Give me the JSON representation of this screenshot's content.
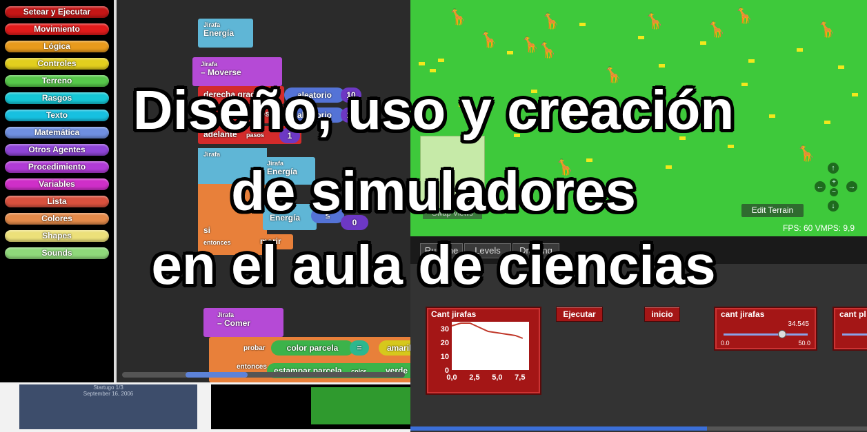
{
  "palette": {
    "categories": [
      {
        "label": "Setear y Ejecutar",
        "color": "#c51616"
      },
      {
        "label": "Movimiento",
        "color": "#e11b1b"
      },
      {
        "label": "Lógica",
        "color": "#e89a1c"
      },
      {
        "label": "Controles",
        "color": "#e2cf1e"
      },
      {
        "label": "Terreno",
        "color": "#57c84a"
      },
      {
        "label": "Rasgos",
        "color": "#15c7d6"
      },
      {
        "label": "Texto",
        "color": "#17c0e0"
      },
      {
        "label": "Matemática",
        "color": "#6f8fe0"
      },
      {
        "label": "Otros Agentes",
        "color": "#8f45d8"
      },
      {
        "label": "Procedimiento",
        "color": "#b03bd6"
      },
      {
        "label": "Variables",
        "color": "#cf2fc8"
      },
      {
        "label": "Lista",
        "color": "#d9513e"
      },
      {
        "label": "Colores",
        "color": "#e48a4a"
      },
      {
        "label": "Shapes",
        "color": "#ece07a"
      },
      {
        "label": "Sounds",
        "color": "#8fd87a"
      }
    ]
  },
  "script": {
    "energia_top": {
      "agent": "Jirafa",
      "label": "Energía"
    },
    "moverse": {
      "agent": "Jirafa",
      "label": "– Moverse"
    },
    "derecha": "derecha  grados",
    "aleatorio1": "aleatorio",
    "aleatorio1_val": "10",
    "izquierda": "izquierda  grados",
    "aleatorio2": "aleatorio",
    "aleatorio2_val": "10",
    "adelante": "adelante",
    "pasos": "pasos",
    "pasos_val": "1",
    "jirafa_label": "Jirafa",
    "energia_mid": {
      "agent": "Jirafa",
      "label": "Energía"
    },
    "si": "si",
    "entonces": "entonces",
    "energia_cond": {
      "agent": "Jirafa",
      "label": "Energía"
    },
    "lte": "≤",
    "zero": "0",
    "morir": "morir",
    "comer": {
      "agent": "Jirafa",
      "label": "– Comer"
    },
    "probar": "probar",
    "color_parcela": "color parcela",
    "eq": "=",
    "amarillo": "amarillo",
    "entonces2": "entonces",
    "estampar": "estampar parcela",
    "color_word": "color",
    "verde": "verde"
  },
  "terrain": {
    "edit_button": "Edit Terrain",
    "swap_button": "Swap Views",
    "fps": "FPS: 60  VMPS: 9,9"
  },
  "tabs": [
    "Runtime",
    "Levels",
    "Drawing"
  ],
  "widgets": {
    "chart_title": "Cant jirafas",
    "btn_ejecutar": "Ejecutar",
    "btn_inicio": "inicio",
    "slider1": {
      "label": "cant jirafas",
      "value": "34.545",
      "min": "0.0",
      "max": "50.0",
      "fraction": 0.69
    },
    "slider2": {
      "label": "cant pl"
    }
  },
  "chart_data": {
    "type": "line",
    "title": "Cant jirafas",
    "x": [
      0,
      1,
      2,
      3,
      4,
      5,
      6,
      7,
      7.8
    ],
    "y": [
      32,
      34,
      34,
      31,
      28,
      27,
      26,
      25,
      23
    ],
    "xticks": [
      "0,0",
      "2,5",
      "5,0",
      "7,5"
    ],
    "yticks": [
      "0",
      "10",
      "20",
      "30"
    ],
    "xlim": [
      0,
      8.5
    ],
    "ylim": [
      0,
      35
    ],
    "line_color": "#c0392b"
  },
  "thumbs": {
    "date_line1": "Startugo 1/3",
    "date_line2": "September 16, 2006"
  },
  "overlay": {
    "line1": "Diseño, uso y creación",
    "line2": "de simuladores",
    "line3": "en el aula de ciencias"
  }
}
